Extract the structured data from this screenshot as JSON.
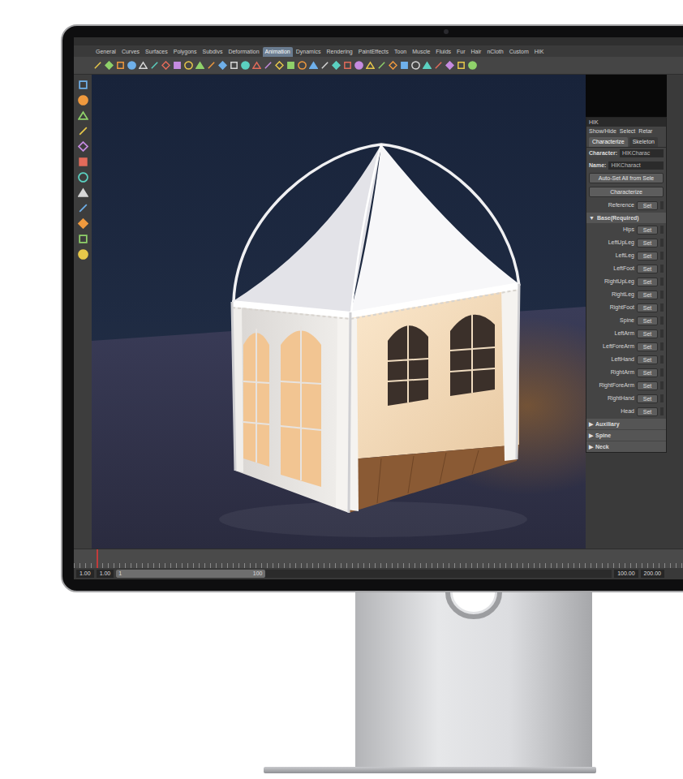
{
  "shelf": {
    "tabs": [
      {
        "label": "General",
        "selected": false
      },
      {
        "label": "Curves",
        "selected": false
      },
      {
        "label": "Surfaces",
        "selected": false
      },
      {
        "label": "Polygons",
        "selected": false
      },
      {
        "label": "Subdivs",
        "selected": false
      },
      {
        "label": "Deformation",
        "selected": false
      },
      {
        "label": "Animation",
        "selected": true
      },
      {
        "label": "Dynamics",
        "selected": false
      },
      {
        "label": "Rendering",
        "selected": false
      },
      {
        "label": "PaintEffects",
        "selected": false
      },
      {
        "label": "Toon",
        "selected": false
      },
      {
        "label": "Muscle",
        "selected": false
      },
      {
        "label": "Fluids",
        "selected": false
      },
      {
        "label": "Fur",
        "selected": false
      },
      {
        "label": "Hair",
        "selected": false
      },
      {
        "label": "nCloth",
        "selected": false
      },
      {
        "label": "Custom",
        "selected": false
      },
      {
        "label": "HIK",
        "selected": false
      }
    ]
  },
  "hik": {
    "title": "HIK",
    "menu": [
      "Show/Hide",
      "Select",
      "Retar"
    ],
    "tabs": [
      {
        "label": "Characterize",
        "selected": true
      },
      {
        "label": "Skeleton",
        "selected": false
      }
    ],
    "character": {
      "label": "Character:",
      "value": "HIKCharac"
    },
    "name": {
      "label": "Name:",
      "value": "HIKCharact"
    },
    "actions": [
      "Auto-Set All from Sele",
      "Characterize"
    ],
    "reference": {
      "label": "Reference",
      "button": "Set"
    },
    "sections": [
      {
        "toggle": "▼",
        "label": "Base(Required)",
        "expanded": true,
        "rows": [
          {
            "label": "Hips",
            "button": "Set"
          },
          {
            "label": "LeftUpLeg",
            "button": "Set"
          },
          {
            "label": "LeftLeg",
            "button": "Set"
          },
          {
            "label": "LeftFoot",
            "button": "Set"
          },
          {
            "label": "RightUpLeg",
            "button": "Set"
          },
          {
            "label": "RightLeg",
            "button": "Set"
          },
          {
            "label": "RightFoot",
            "button": "Set"
          },
          {
            "label": "Spine",
            "button": "Set"
          },
          {
            "label": "LeftArm",
            "button": "Set"
          },
          {
            "label": "LeftForeArm",
            "button": "Set"
          },
          {
            "label": "LeftHand",
            "button": "Set"
          },
          {
            "label": "RightArm",
            "button": "Set"
          },
          {
            "label": "RightForeArm",
            "button": "Set"
          },
          {
            "label": "RightHand",
            "button": "Set"
          },
          {
            "label": "Head",
            "button": "Set"
          }
        ]
      },
      {
        "toggle": "▶",
        "label": "Auxiliary",
        "expanded": false,
        "rows": []
      },
      {
        "toggle": "▶",
        "label": "Spine",
        "expanded": false,
        "rows": []
      },
      {
        "toggle": "▶",
        "label": "Neck",
        "expanded": false,
        "rows": []
      }
    ]
  },
  "timeline": {
    "start": "1.00",
    "current": "1.00",
    "range": {
      "low": "1",
      "high": "100",
      "level": 0.3
    },
    "end": "100.00",
    "max": "200.00"
  }
}
